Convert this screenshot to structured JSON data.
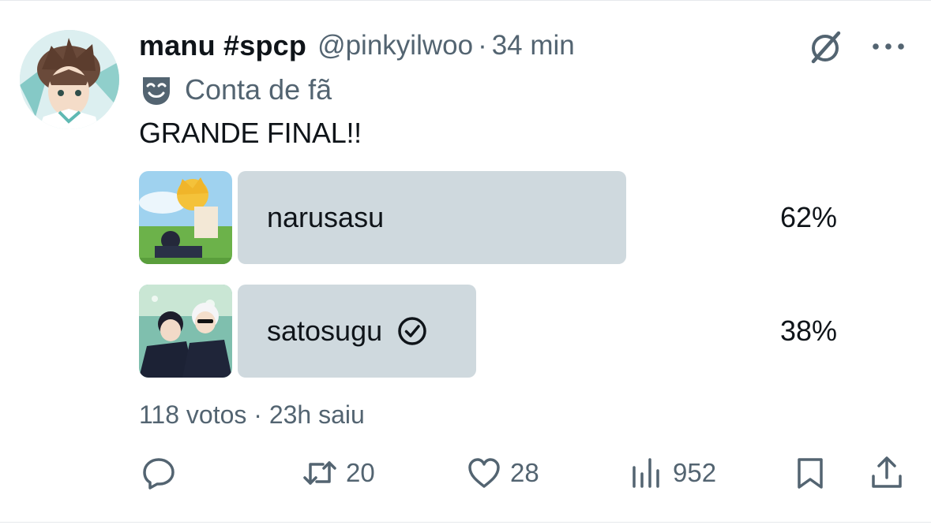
{
  "post": {
    "display_name": "manu #spcp",
    "handle": "@pinkyilwoo",
    "separator": "·",
    "time": "34 min",
    "fan_label": "Conta de fã",
    "text": "GRANDE FINAL!!"
  },
  "poll": {
    "options": [
      {
        "label": "narusasu",
        "percent": "62%",
        "fraction": 0.62,
        "selected": false
      },
      {
        "label": "satosugu",
        "percent": "38%",
        "fraction": 0.38,
        "selected": true
      }
    ],
    "meta": "118 votos · 23h saiu"
  },
  "actions": {
    "reply_count": "",
    "repost_count": "20",
    "like_count": "28",
    "views_count": "952"
  },
  "icons": {
    "fan_account": "mask-icon",
    "grok": "grok-icon",
    "more": "more-icon",
    "selected_check": "check-circle-icon",
    "reply": "reply-icon",
    "repost": "repost-icon",
    "like": "heart-icon",
    "views": "views-icon",
    "bookmark": "bookmark-icon",
    "share": "share-icon"
  },
  "colors": {
    "text": "#0f1419",
    "secondary": "#536471",
    "poll_bar": "#cfd9de"
  }
}
